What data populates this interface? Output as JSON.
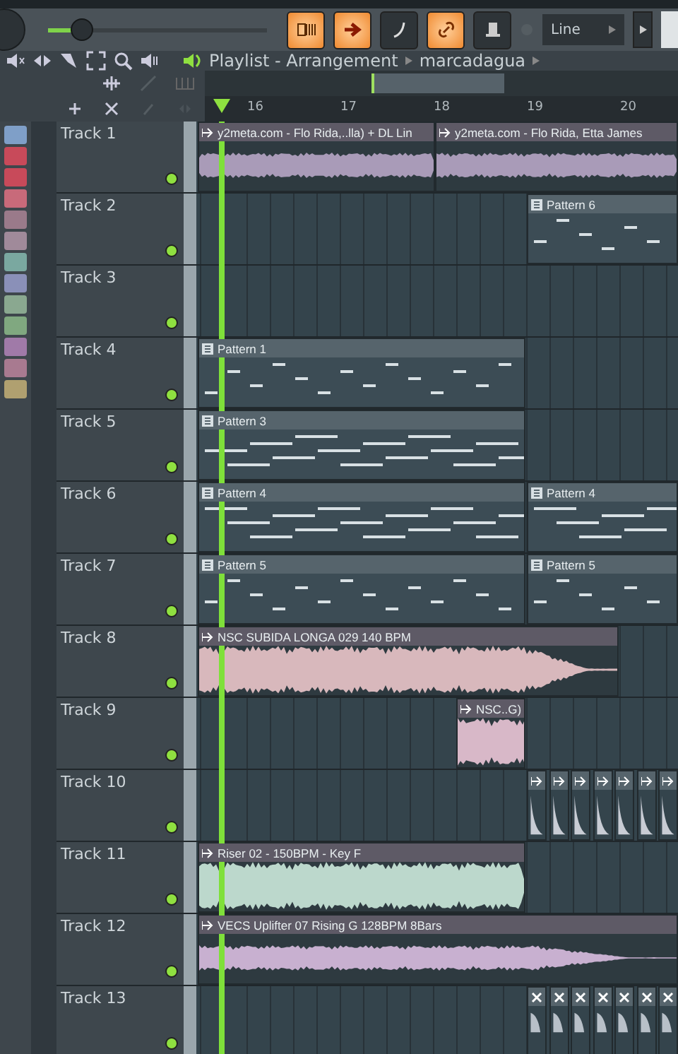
{
  "toolbar": {
    "volume": {
      "level": 0.15
    },
    "buttons": [
      {
        "on": true
      },
      {
        "on": true
      },
      {
        "on": false
      },
      {
        "on": true
      },
      {
        "on": false
      }
    ],
    "snap": "Line"
  },
  "playlist": {
    "title": "Playlist - Arrangement",
    "arrangement": "marcadagua"
  },
  "ruler": [
    "16",
    "17",
    "18",
    "19",
    "20"
  ],
  "pattern_picker": [
    {
      "color": "#7f9fc8"
    },
    {
      "color": "#c84a5a"
    },
    {
      "color": "#c84a5a"
    },
    {
      "color": "#c86a7a"
    },
    {
      "color": "#9a7a8a"
    },
    {
      "color": "#a08a9a"
    },
    {
      "color": "#7aa8a0"
    },
    {
      "color": "#8a90b8"
    },
    {
      "color": "#8aa890"
    },
    {
      "color": "#80a880"
    },
    {
      "color": "#a07aa8"
    },
    {
      "color": "#a87a90"
    },
    {
      "color": "#b0a070"
    }
  ],
  "tracks": [
    {
      "name": "Track 1",
      "enabled": true,
      "clips": [
        {
          "kind": "audio",
          "label": "y2meta.com - Flo Rida,..lla) + DL Lin",
          "color": "#a99bb8"
        },
        {
          "kind": "audio",
          "label": "y2meta.com - Flo Rida, Etta James",
          "color": "#a99bb8"
        }
      ]
    },
    {
      "name": "Track 2",
      "enabled": true,
      "clips": [
        {
          "kind": "pattern",
          "label": "Pattern 6"
        }
      ]
    },
    {
      "name": "Track 3",
      "enabled": true
    },
    {
      "name": "Track 4",
      "enabled": true,
      "clips": [
        {
          "kind": "pattern",
          "label": "Pattern 1"
        }
      ]
    },
    {
      "name": "Track 5",
      "enabled": true,
      "clips": [
        {
          "kind": "pattern",
          "label": "Pattern 3"
        }
      ]
    },
    {
      "name": "Track 6",
      "enabled": true,
      "clips": [
        {
          "kind": "pattern",
          "label": "Pattern 4"
        },
        {
          "kind": "pattern",
          "label": "Pattern 4"
        }
      ]
    },
    {
      "name": "Track 7",
      "enabled": true,
      "clips": [
        {
          "kind": "pattern",
          "label": "Pattern 5"
        },
        {
          "kind": "pattern",
          "label": "Pattern 5"
        }
      ]
    },
    {
      "name": "Track 8",
      "enabled": true,
      "clips": [
        {
          "kind": "audio",
          "label": "NSC SUBIDA LONGA 029 140 BPM",
          "color": "#d8b8bc"
        }
      ]
    },
    {
      "name": "Track 9",
      "enabled": true,
      "clips": [
        {
          "kind": "audio",
          "label": "NSC..G)",
          "color": "#d8b8c8"
        }
      ]
    },
    {
      "name": "Track 10",
      "enabled": true,
      "clips": [
        {
          "kind": "shot"
        },
        {
          "kind": "shot"
        },
        {
          "kind": "shot"
        },
        {
          "kind": "shot"
        },
        {
          "kind": "shot"
        },
        {
          "kind": "shot"
        },
        {
          "kind": "shot"
        }
      ]
    },
    {
      "name": "Track 11",
      "enabled": true,
      "clips": [
        {
          "kind": "audio",
          "label": "Riser 02 - 150BPM - Key F",
          "color": "#bcd8cc"
        }
      ]
    },
    {
      "name": "Track 12",
      "enabled": true,
      "clips": [
        {
          "kind": "audio",
          "label": "VECS Uplifter 07 Rising G 128BPM 8Bars",
          "color": "#c8b0d0"
        }
      ]
    },
    {
      "name": "Track 13",
      "enabled": true,
      "clips": [
        {
          "kind": "cut"
        },
        {
          "kind": "cut"
        },
        {
          "kind": "cut"
        },
        {
          "kind": "cut"
        },
        {
          "kind": "cut"
        },
        {
          "kind": "cut"
        },
        {
          "kind": "cut"
        }
      ]
    }
  ]
}
